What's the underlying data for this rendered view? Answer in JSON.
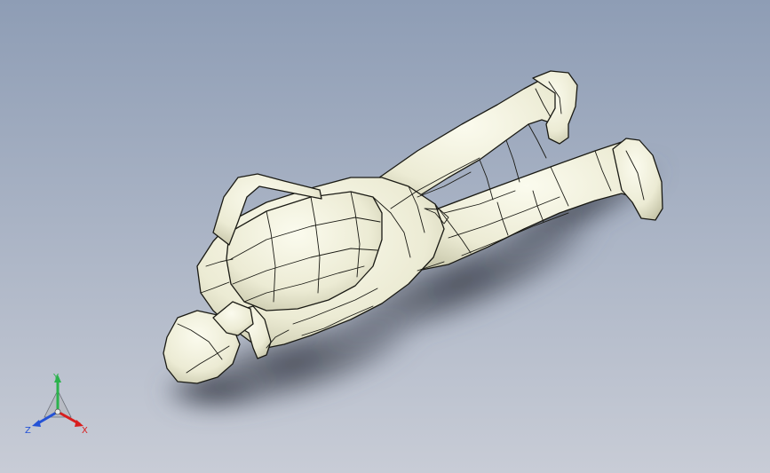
{
  "viewport": {
    "background_top": "#8e9db5",
    "background_bottom": "#c8ccd6",
    "model_fill": "#f3f2e0",
    "model_shade": "#c7c6ac",
    "edge_color": "#1a1a14",
    "shadow_color": "#3a3f4a"
  },
  "triad": {
    "x_label": "X",
    "y_label": "Y",
    "z_label": "Z",
    "x_color": "#d81e1e",
    "y_color": "#2bb24c",
    "z_color": "#2452d6"
  }
}
